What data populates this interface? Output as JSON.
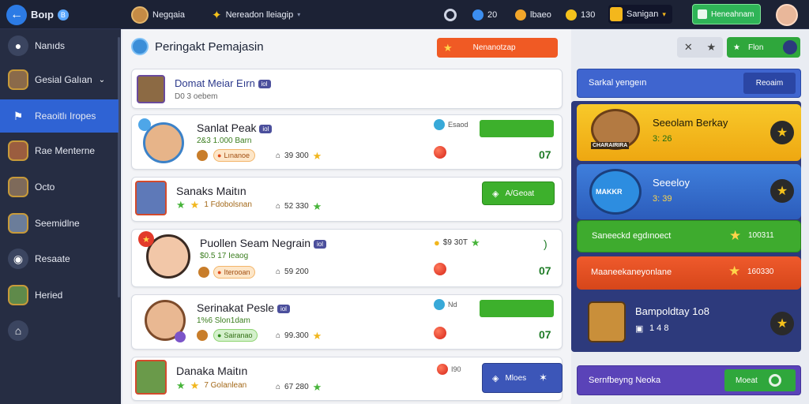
{
  "topbar": {
    "logo_text": "Boıp",
    "logo_badge": "B",
    "profile_name": "Negqaia",
    "notification_text": "Nereadon lleiagip",
    "stat_1": "20",
    "stat_2": "lbaeo",
    "stat_3": "130",
    "store_label": "Sanigan",
    "cta_label": "Heneahnam"
  },
  "sidebar": {
    "items": [
      {
        "label": "Nanıds",
        "icon": "map-pin-icon",
        "active": false
      },
      {
        "label": "Gesial Galıan",
        "icon": "avatar-icon",
        "active": false
      },
      {
        "label": "Reaoitlı Iropes",
        "icon": "flag-icon",
        "active": true
      },
      {
        "label": "Rae Menterne",
        "icon": "avatar-icon",
        "active": false
      },
      {
        "label": "Octo",
        "icon": "avatar-icon",
        "active": false
      },
      {
        "label": "Seemidlne",
        "icon": "avatar-icon",
        "active": false
      },
      {
        "label": "Resaate",
        "icon": "camera-icon",
        "active": false
      },
      {
        "label": "Heried",
        "icon": "avatar-icon",
        "active": false
      }
    ]
  },
  "page": {
    "title": "Peringakt Pemajasin",
    "primary_button": "Nenanotzap"
  },
  "list": {
    "header": {
      "name": "Domat Meiar Eırn",
      "tag": "iol",
      "sub": "D0 3 oebem"
    },
    "rows": [
      {
        "name": "Sanlat Peak",
        "tag": "iol",
        "sub": "2&3 1.000 Barn",
        "chip": "Lınanoe",
        "chip_color": "orange",
        "stat": "39 300",
        "meter_label": "Esaod",
        "score": "07",
        "action": ""
      },
      {
        "name": "Sanaks Maitın",
        "tag": "",
        "sub": "",
        "chip": "1 Fdobolsnan",
        "chip_color": "none",
        "stat": "52 330",
        "meter_label": "",
        "score": "",
        "action": "A/Geoat"
      },
      {
        "name": "Puollen Seam Negrain",
        "tag": "iol",
        "sub": "$0.5 17 Ieaog",
        "chip": "Iterooan",
        "chip_color": "orange",
        "stat": "59 200",
        "meter_label": "$9 30T",
        "score": "07",
        "action": ""
      },
      {
        "name": "Serinakat Pesle",
        "tag": "iol",
        "sub": "1%6 Slon1dam",
        "chip": "Sairanao",
        "chip_color": "green",
        "stat": "99.300",
        "meter_label": "Nd",
        "score": "07",
        "action": ""
      },
      {
        "name": "Danaka Maitın",
        "tag": "",
        "sub": "",
        "chip": "7 Golanlean",
        "chip_color": "none",
        "stat": "67 280",
        "meter_label": "I90",
        "score": "",
        "action": "Mloes"
      }
    ]
  },
  "rightpanel": {
    "tools": {
      "cta": "Flon"
    },
    "search": {
      "placeholder": "Sarkal yengeın",
      "button": "Reoaim"
    },
    "cards": [
      {
        "title": "Seeolam Berkay",
        "sub": "3: 26",
        "badge": "CHARAIRIRA"
      },
      {
        "title": "Seeeloy",
        "sub": "3: 39",
        "badge": "MAKKR"
      }
    ],
    "green_banner": {
      "label": "Saneeckd egdınoect",
      "value": "100311"
    },
    "red_banner": {
      "label": "Maaneekaneyonlane",
      "value": "160330"
    },
    "player": {
      "title": "Bampoldtay 1o8",
      "sub": "1 4 8"
    },
    "footer": {
      "label": "Sernfbeyng Neoka",
      "button": "Moeat"
    }
  },
  "colors": {
    "topbar": "#1c2235",
    "sidebar": "#262d43",
    "active": "#2f63d4",
    "orange_btn": "#f05a24",
    "green": "#3db02c",
    "gold": "#f4b71c",
    "blue_card": "#2f6fc9",
    "panel": "#2d3a7c"
  }
}
